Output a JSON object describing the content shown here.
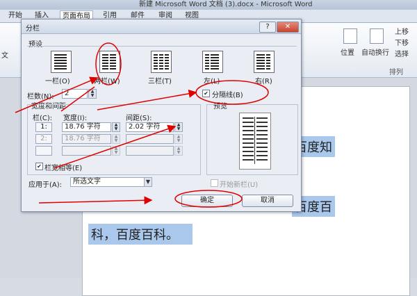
{
  "window": {
    "title": "新建 Microsoft Word 文档 (3).docx - Microsoft Word"
  },
  "tabs": [
    "开始",
    "插入",
    "页面布局",
    "引用",
    "邮件",
    "审阅",
    "视图"
  ],
  "active_tab": "页面布局",
  "ribbon": {
    "left_label": "文",
    "position_label": "位置",
    "wrap_label": "自动换行",
    "up_label": "上移",
    "down_label": "下移",
    "select_label": "选择",
    "arrange_label": "排列"
  },
  "document": {
    "line1": "百度知",
    "line2": "百度百",
    "line3": "科，百度百科。"
  },
  "dialog": {
    "title": "分栏",
    "help": "?",
    "close": "✕",
    "presets_label": "预设",
    "presets": [
      "一栏(O)",
      "两栏(W)",
      "三栏(T)",
      "左(L)",
      "右(R)"
    ],
    "num_cols_label": "栏数(N):",
    "num_cols_value": "2",
    "separator_label": "分隔线(B)",
    "width_spacing_label": "宽度和间距",
    "col_header": "栏(C):",
    "width_header": "宽度(I):",
    "spacing_header": "间距(S):",
    "rows": [
      {
        "num": "1:",
        "width": "18.76 字符",
        "spacing": "2.02 字符"
      },
      {
        "num": "2:",
        "width": "18.76 字符",
        "spacing": ""
      },
      {
        "num": "",
        "width": "",
        "spacing": ""
      }
    ],
    "equal_width_label": "栏宽相等(E)",
    "preview_label": "预览",
    "apply_label": "应用于(A):",
    "apply_value": "所选文字",
    "new_col_label": "开始新栏(U)",
    "ok": "确定",
    "cancel": "取消"
  },
  "annotation_color": "#e00000"
}
